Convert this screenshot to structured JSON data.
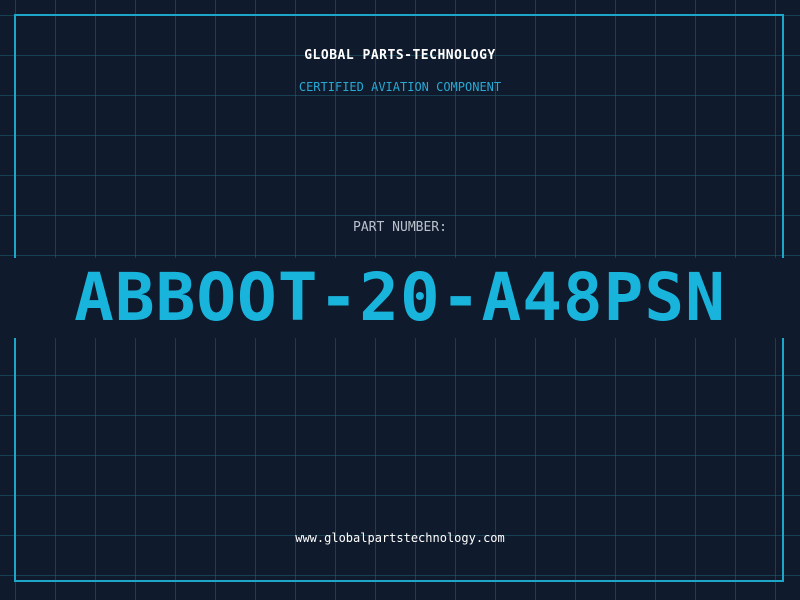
{
  "header": {
    "company": "GLOBAL PARTS-TECHNOLOGY",
    "subtitle": "CERTIFIED AVIATION COMPONENT"
  },
  "part": {
    "label": "PART NUMBER:",
    "number": "ABBOOT-20-A48PSN"
  },
  "footer": {
    "website": "www.globalpartstechnology.com"
  },
  "colors": {
    "background": "#0f1a2c",
    "grid": "#226e82",
    "frame": "#1ea6c9",
    "accent": "#19b4dc",
    "text": "#ffffff",
    "muted": "#b9c2cc"
  }
}
